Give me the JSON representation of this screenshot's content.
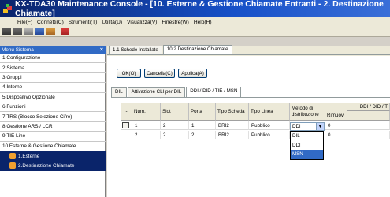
{
  "window": {
    "title": "KX-TDA30 Maintenance Console - [10. Esterne & Gestione Chiamate Entranti - 2. Destinazione Chiamate]"
  },
  "menu": [
    "File(F)",
    "Connetti(C)",
    "Strumenti(T)",
    "Utilità(U)",
    "Visualizza(V)",
    "Finestre(W)",
    "Help(H)"
  ],
  "sidebar": {
    "header": "Menu Sistema",
    "items": [
      "1.Configurazione",
      "2.Sistema",
      "3.Gruppi",
      "4.Interne",
      "5.Dispositivo Opzionale",
      "6.Funzioni",
      "7.TRS (Blocco Selezione Cifre)",
      "8.Gestione ARS / LCR",
      "9.TIE Line",
      "10.Esterne & Gestione Chiamate ..."
    ],
    "subitems": [
      "1.Esterne",
      "2.Destinazione Chiamate"
    ]
  },
  "tabs": {
    "items": [
      "1.1 Schede Installate",
      "10.2 Destinazione Chiamate"
    ]
  },
  "buttons": {
    "ok": "OK(O)",
    "cancel": "Cancella(C)",
    "apply": "Applica(A)"
  },
  "subtabs": [
    "DIL",
    "Attivazione CLI per DIL",
    "DDI / DID / TIE / MSN"
  ],
  "table": {
    "headers": [
      "-",
      "Num.",
      "Slot",
      "Porta",
      "Tipo Scheda",
      "Tipo Linea",
      "Metodo di distribuzione",
      "Rimuovi",
      "DDI / DID / T"
    ],
    "rows": [
      {
        "num": "1",
        "slot": "2",
        "porta": "1",
        "tipo_scheda": "BRI2",
        "tipo_linea": "Pubblico",
        "metodo": "DDI",
        "rimuovi": "0"
      },
      {
        "num": "2",
        "slot": "2",
        "porta": "2",
        "tipo_scheda": "BRI2",
        "tipo_linea": "Pubblico",
        "metodo": "DDI",
        "rimuovi": "0"
      }
    ]
  },
  "dropdown": {
    "options": [
      "DIL",
      "DDI",
      "MSN"
    ],
    "selected": "DDI",
    "highlight": "MSN"
  }
}
